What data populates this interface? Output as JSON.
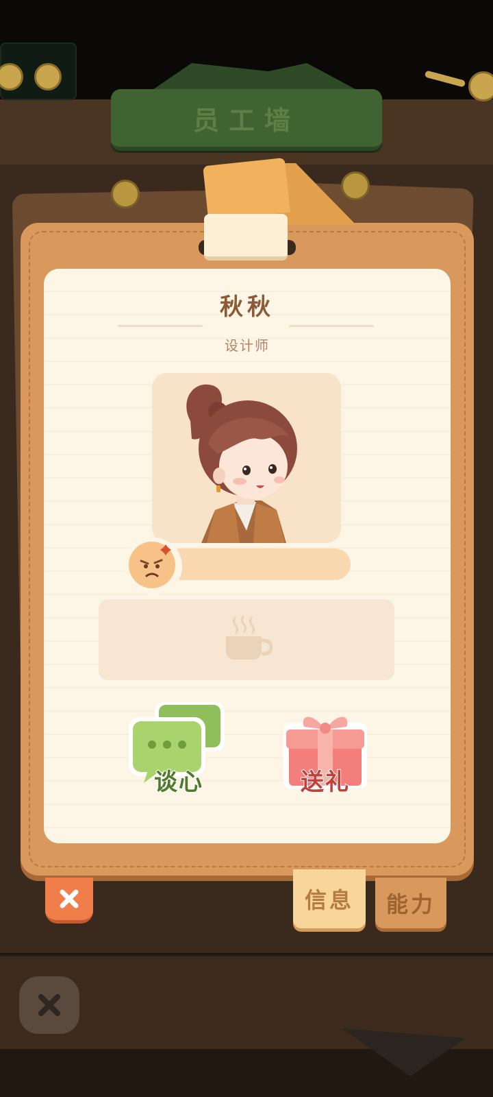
{
  "header": {
    "title": "员工墙"
  },
  "employee": {
    "name": "秋秋",
    "job_title": "设计师",
    "mood": "angry"
  },
  "activity": {
    "icon": "coffee-cup-icon"
  },
  "actions": {
    "talk_label": "谈心",
    "gift_label": "送礼"
  },
  "tabs": {
    "info_label": "信息",
    "ability_label": "能力",
    "active": "信息"
  },
  "colors": {
    "card": "#d9995c",
    "paper": "#fdf5e6",
    "sign": "#3f6331",
    "close": "#f07e4a"
  }
}
